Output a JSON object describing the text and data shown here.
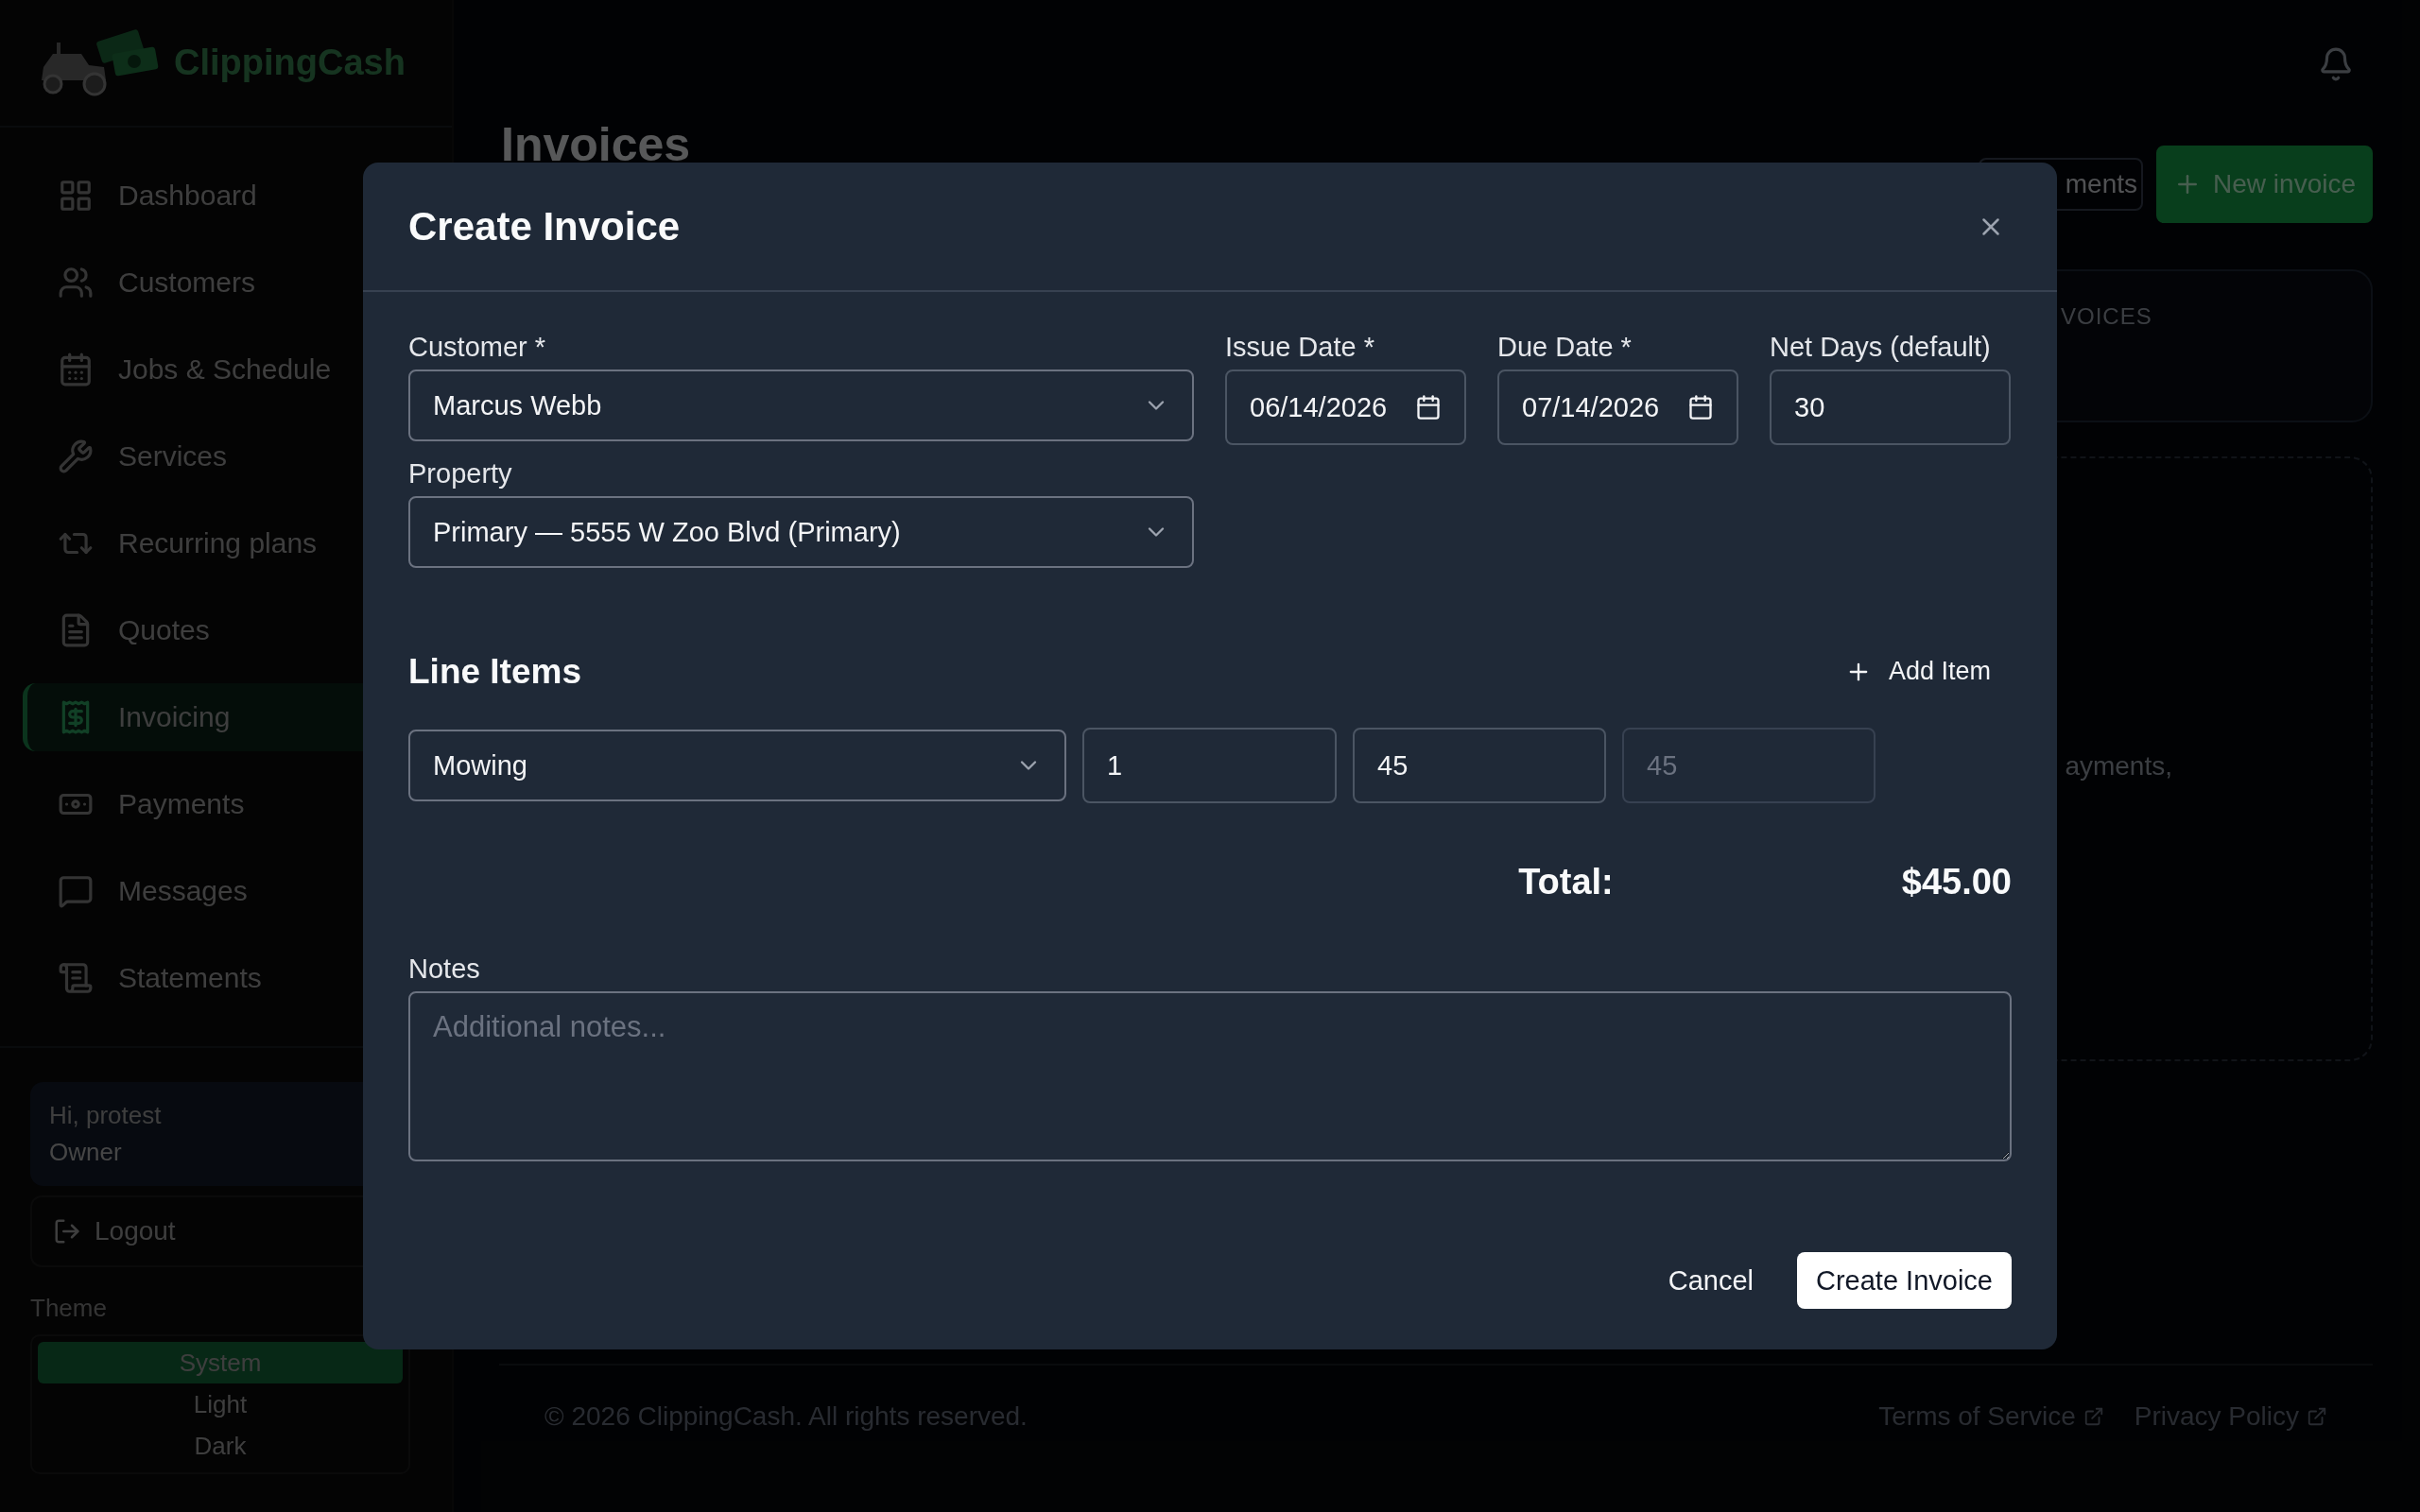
{
  "sidebar": {
    "brand": "ClippingCash",
    "nav": [
      {
        "label": "Dashboard",
        "selected": false
      },
      {
        "label": "Customers",
        "selected": false
      },
      {
        "label": "Jobs & Schedule",
        "selected": false
      },
      {
        "label": "Services",
        "selected": false
      },
      {
        "label": "Recurring plans",
        "selected": false
      },
      {
        "label": "Quotes",
        "selected": false
      },
      {
        "label": "Invoicing",
        "selected": true
      },
      {
        "label": "Payments",
        "selected": false
      },
      {
        "label": "Messages",
        "selected": false
      },
      {
        "label": "Statements",
        "selected": false
      }
    ],
    "user": {
      "greeting": "Hi, protest",
      "role": "Owner"
    },
    "logout": "Logout",
    "theme": {
      "label": "Theme",
      "options": [
        {
          "label": "System",
          "selected": true
        },
        {
          "label": "Light",
          "selected": false
        },
        {
          "label": "Dark",
          "selected": false
        }
      ]
    }
  },
  "page": {
    "title": "Invoices",
    "actions": [
      {
        "label": "ments",
        "kind": "outline"
      },
      {
        "label": "New invoice",
        "kind": "primary"
      }
    ],
    "stat_label": "VOICES",
    "empty_text": "ayments,"
  },
  "footer": {
    "copyright": "© 2026 ClippingCash. All rights reserved.",
    "links": [
      "Terms of Service",
      "Privacy Policy"
    ]
  },
  "modal": {
    "title": "Create Invoice",
    "customer": {
      "label": "Customer *",
      "value": "Marcus Webb"
    },
    "issue_date": {
      "label": "Issue Date *",
      "value": "06/14/2026"
    },
    "due_date": {
      "label": "Due Date *",
      "value": "07/14/2026"
    },
    "net_days": {
      "label": "Net Days (default)",
      "value": "30"
    },
    "property": {
      "label": "Property",
      "value": "Primary — 5555 W Zoo Blvd (Primary)"
    },
    "line_items_title": "Line Items",
    "add_item": "Add Item",
    "line_items": [
      {
        "service": "Mowing",
        "quantity": "1",
        "price": "45",
        "amount": "45"
      }
    ],
    "total_label": "Total:",
    "total_value": "$45.00",
    "notes": {
      "label": "Notes",
      "placeholder": "Additional notes..."
    },
    "cancel": "Cancel",
    "submit": "Create Invoice"
  }
}
